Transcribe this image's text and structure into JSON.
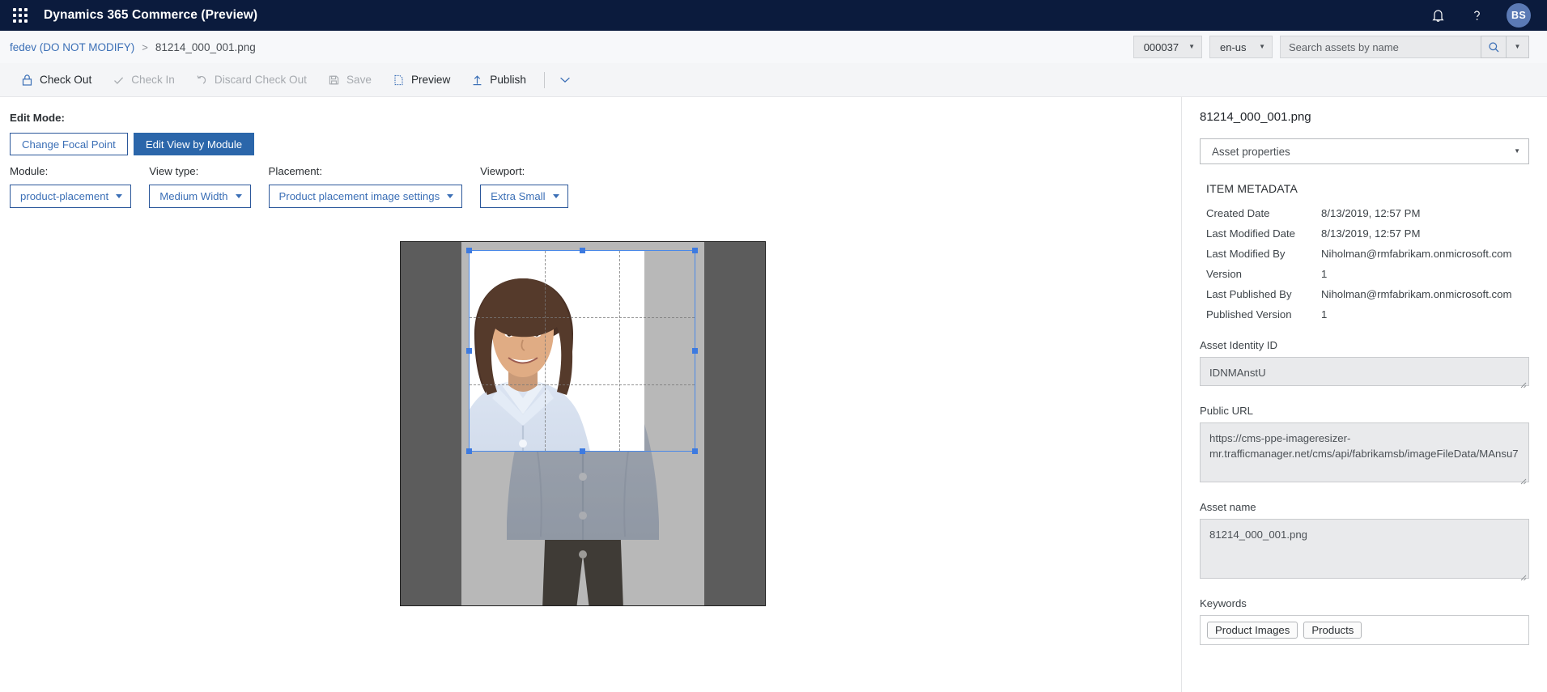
{
  "suite": {
    "app_title": "Dynamics 365 Commerce (Preview)",
    "waffle_icon": "waffle-grid-icon",
    "notifications_icon": "bell-icon",
    "help_icon": "question-mark-icon",
    "avatar_initials": "BS"
  },
  "breadcrumb": {
    "root": "fedev (DO NOT MODIFY)",
    "separator": ">",
    "current": "81214_000_001.png",
    "channel": "000037",
    "locale": "en-us",
    "search_placeholder": "Search assets by name",
    "search_value": "",
    "search_icon": "magnifier-icon",
    "search_dropdown_icon": "chevron-down-icon"
  },
  "toolbar": {
    "check_out": "Check Out",
    "check_in": "Check In",
    "discard": "Discard Check Out",
    "save": "Save",
    "preview": "Preview",
    "publish": "Publish",
    "overflow_icon": "chevron-down-icon"
  },
  "editor": {
    "edit_mode_label": "Edit Mode:",
    "mode_focal": "Change Focal Point",
    "mode_module": "Edit View by Module",
    "selectors": [
      {
        "label": "Module:",
        "value": "product-placement"
      },
      {
        "label": "View type:",
        "value": "Medium Width"
      },
      {
        "label": "Placement:",
        "value": "Product placement image settings"
      },
      {
        "label": "Viewport:",
        "value": "Extra Small"
      }
    ]
  },
  "properties": {
    "title": "81214_000_001.png",
    "selector_value": "Asset properties",
    "section_title": "ITEM METADATA",
    "metadata": [
      {
        "key": "Created Date",
        "value": "8/13/2019, 12:57 PM"
      },
      {
        "key": "Last Modified Date",
        "value": "8/13/2019, 12:57 PM"
      },
      {
        "key": "Last Modified By",
        "value": "Niholman@rmfabrikam.onmicrosoft.com"
      },
      {
        "key": "Version",
        "value": "1"
      },
      {
        "key": "Last Published By",
        "value": "Niholman@rmfabrikam.onmicrosoft.com"
      },
      {
        "key": "Published Version",
        "value": "1"
      }
    ],
    "asset_identity_label": "Asset Identity ID",
    "asset_identity_value": "IDNMAnstU",
    "public_url_label": "Public URL",
    "public_url_value": "https://cms-ppe-imageresizer-mr.trafficmanager.net/cms/api/fabrikamsb/imageFileData/MAnsu7",
    "asset_name_label": "Asset name",
    "asset_name_value": "81214_000_001.png",
    "keywords_label": "Keywords",
    "keywords": [
      "Product Images",
      "Products"
    ]
  },
  "colors": {
    "suite_bar": "#0b1b3d",
    "accent": "#2b66aa",
    "link": "#3b6fb6",
    "crop_handle": "#3d7ae0",
    "canvas_backdrop": "#808080"
  }
}
